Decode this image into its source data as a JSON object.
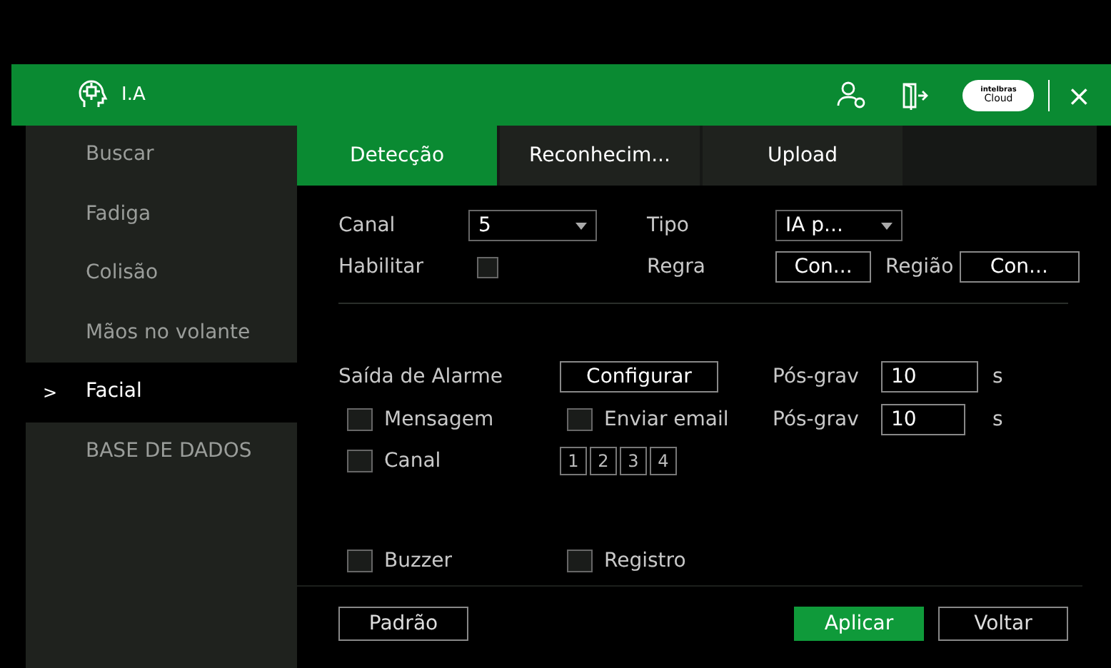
{
  "window": {
    "title": "I.A",
    "cloud_logo": [
      "intelbras",
      "Cloud"
    ],
    "close": "×"
  },
  "sidebar": {
    "items": [
      {
        "label": "Buscar",
        "selected": false
      },
      {
        "label": "Fadiga",
        "selected": false
      },
      {
        "label": "Colisão",
        "selected": false
      },
      {
        "label": "Mãos no volante",
        "selected": false
      },
      {
        "label": "Facial",
        "selected": true,
        "marker": ">"
      },
      {
        "label": "BASE DE DADOS",
        "selected": false
      }
    ]
  },
  "tabs": [
    {
      "label": "Detecção",
      "selected": true
    },
    {
      "label": "Reconhecim...",
      "selected": false
    },
    {
      "label": "Upload",
      "selected": false
    }
  ],
  "canal": {
    "label": "Canal",
    "value": "5"
  },
  "tipo": {
    "label": "Tipo",
    "value": "IA p..."
  },
  "habilitar": {
    "label": "Habilitar",
    "checked": false
  },
  "regra": {
    "label": "Regra",
    "button": "Con..."
  },
  "regiao": {
    "label": "Região",
    "button": "Con..."
  },
  "alarm_output": {
    "label": "Saída de Alarme",
    "button": "Configurar",
    "post_label": "Pós-grav",
    "post_value": "10",
    "unit": "s"
  },
  "mensagem": {
    "label": "Mensagem",
    "checked": false
  },
  "email": {
    "label": "Enviar email",
    "checked": false,
    "post_label": "Pós-grav",
    "post_value": "10",
    "unit": "s"
  },
  "canal_out": {
    "label": "Canal",
    "checked": false,
    "channels": [
      "1",
      "2",
      "3",
      "4"
    ]
  },
  "buzzer": {
    "label": "Buzzer",
    "checked": false
  },
  "registro": {
    "label": "Registro",
    "checked": false
  },
  "buttons": [
    {
      "label": "Padrão",
      "kind": "default"
    },
    {
      "label": "Aplicar",
      "kind": "primary"
    },
    {
      "label": "Voltar",
      "kind": "default"
    }
  ]
}
